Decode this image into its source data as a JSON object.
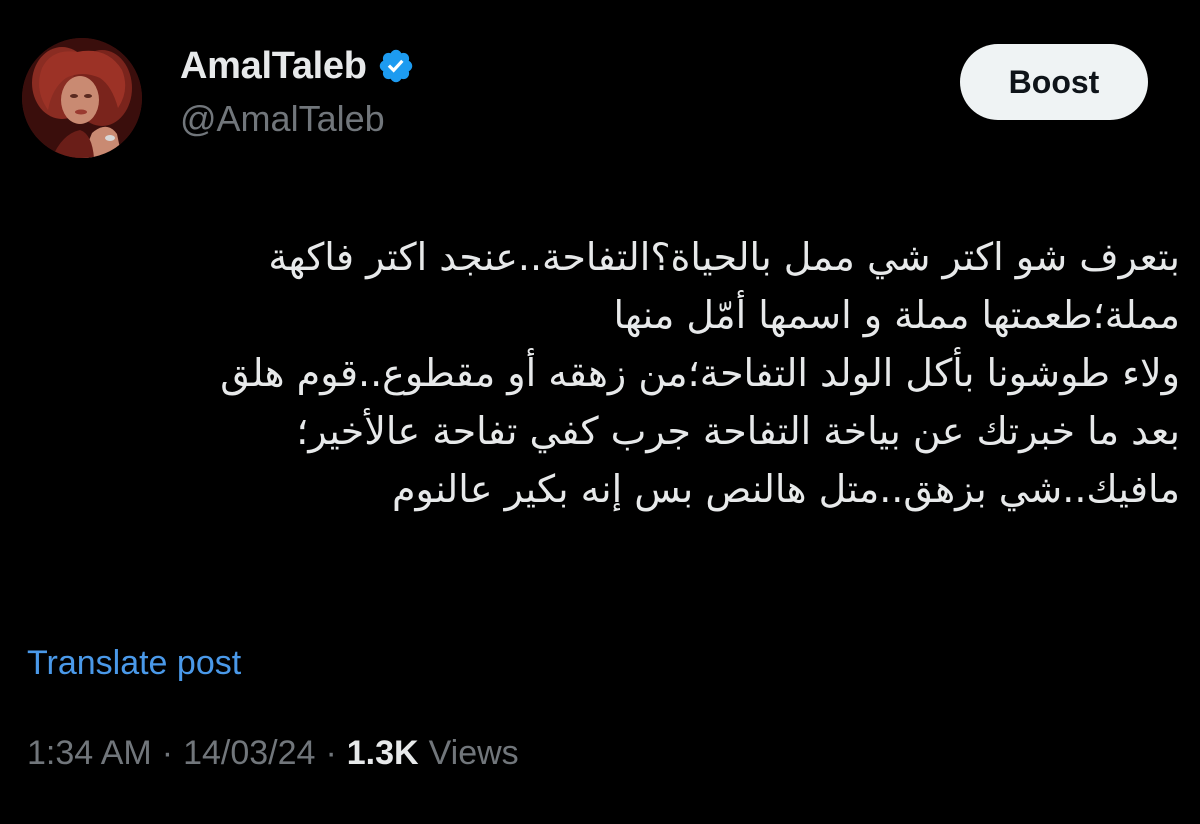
{
  "author": {
    "display_name": "AmalTaleb",
    "handle": "@AmalTaleb",
    "verified": true,
    "verified_badge_color": "#1d9bf0"
  },
  "actions": {
    "boost_label": "Boost"
  },
  "post": {
    "lines": [
      "بتعرف شو اكتر شي ممل بالحياة؟التفاحة..عنجد اكتر فاكهة",
      "مملة؛طعمتها مملة و اسمها أمّل منها",
      "ولاء طوشونا بأكل الولد التفاحة؛من زهقه أو مقطوع..قوم هلق",
      "بعد ما خبرتك عن بياخة التفاحة جرب كفي تفاحة عالأخير؛",
      "مافيك..شي بزهق..متل هالنص بس إنه بكير عالنوم"
    ],
    "translate_label": "Translate post"
  },
  "meta": {
    "time": "1:34 AM",
    "separator": "·",
    "date": "14/03/24",
    "views_count": "1.3K",
    "views_label": "Views"
  },
  "colors": {
    "background": "#000000",
    "text_primary": "#e7e9ea",
    "text_secondary": "#71767b",
    "link": "#4a99e9",
    "button_bg": "#eff3f4"
  }
}
